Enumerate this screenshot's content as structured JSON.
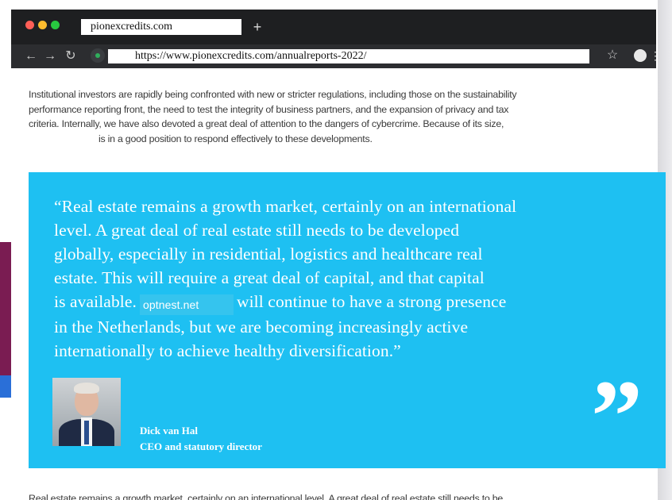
{
  "colors": {
    "quote_bg": "#1ec0f2",
    "brand_maroon": "#8a1f55",
    "chrome_dark": "#1e1f21"
  },
  "browser": {
    "tab_title": "pionexcredits.com",
    "new_tab_glyph": "+",
    "url": "https://www.pionexcredits.com/annualreports-2022/",
    "icons": [
      "back-icon",
      "forward-icon",
      "reload-icon",
      "secure-icon",
      "star-icon",
      "profile-icon",
      "menu-icon"
    ]
  },
  "article": {
    "intro_lines": [
      "Institutional investors are rapidly being confronted with new or stricter regulations, including those on the sustainability",
      "performance reporting front, the need to test the integrity of business partners, and the expansion of privacy and tax",
      "criteria. Internally, we have also devoted a great deal of attention to the dangers of cybercrime. Because of its size,",
      "is in a good position to respond effectively to these developments."
    ],
    "quote": {
      "lines": [
        "“Real estate remains a growth market, certainly on an international",
        "level. A great deal of real estate still needs to be developed",
        "globally, especially in residential, logistics and healthcare real",
        "estate. This will require a great deal of capital, and that capital"
      ],
      "line5_before": "is available.",
      "watermark": "optnest.net",
      "line5_after": "will continue to have a strong presence",
      "lines_end": [
        "in the Netherlands, but we are becoming increasingly active",
        "internationally to achieve healthy diversification.”"
      ],
      "author_name": "Dick van Hal",
      "author_title": "CEO and  statutory director",
      "quote_mark": "”"
    },
    "outro": "Real estate remains a growth market, certainly on an international level. A great deal of real estate still needs to be"
  }
}
